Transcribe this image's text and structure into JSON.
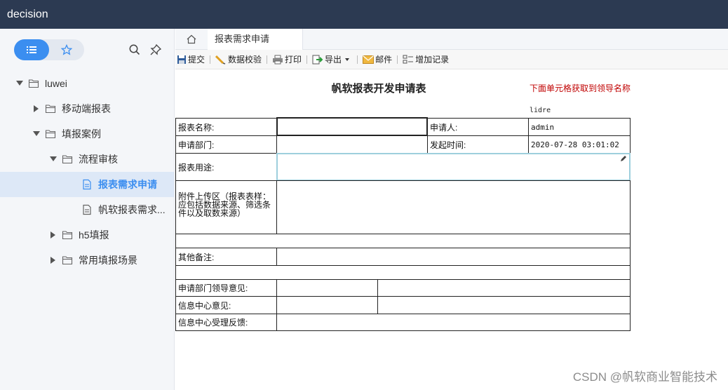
{
  "app": {
    "title": "decision"
  },
  "sidebar": {
    "tree": [
      {
        "label": "luwei",
        "level": 0,
        "expanded": true,
        "type": "folder"
      },
      {
        "label": "移动端报表",
        "level": 1,
        "expanded": false,
        "type": "folder"
      },
      {
        "label": "填报案例",
        "level": 1,
        "expanded": true,
        "type": "folder"
      },
      {
        "label": "流程审核",
        "level": 2,
        "expanded": true,
        "type": "folder"
      },
      {
        "label": "报表需求申请",
        "level": 3,
        "type": "file",
        "active": true
      },
      {
        "label": "帆软报表需求...",
        "level": 3,
        "type": "file"
      },
      {
        "label": "h5填报",
        "level": 2,
        "expanded": false,
        "type": "folder"
      },
      {
        "label": "常用填报场景",
        "level": 2,
        "expanded": false,
        "type": "folder"
      }
    ]
  },
  "tabs": {
    "active": "报表需求申请"
  },
  "toolbar": {
    "submit": "提交",
    "verify": "数据校验",
    "print": "打印",
    "export": "导出",
    "mail": "邮件",
    "add_record": "增加记录"
  },
  "report": {
    "title": "帆软报表开发申请表",
    "note": "下面单元格获取到领导名称",
    "leader": "lidre",
    "labels": {
      "name": "报表名称:",
      "applicant": "申请人:",
      "dept": "申请部门:",
      "time": "发起时间:",
      "usage": "报表用途:",
      "attachment": "附件上传区（报表表样：应包括数据来源、筛选条件以及取数来源）",
      "remark": "其他备注:",
      "dept_opinion": "申请部门领导意见:",
      "info_opinion": "信息中心意见:",
      "info_feedback": "信息中心受理反馈:"
    },
    "values": {
      "applicant": "admin",
      "time": "2020-07-28 03:01:02"
    }
  },
  "watermark": "CSDN @帆软商业智能技术",
  "colors": {
    "topbar": "#2c3a52",
    "accent": "#3b8ef0",
    "note": "#c00000"
  }
}
